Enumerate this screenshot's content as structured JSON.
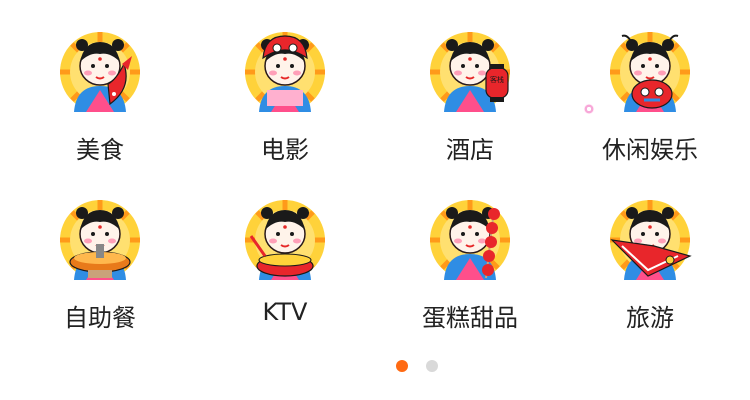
{
  "categories": [
    {
      "label": "美食",
      "icon": "fish-figure-icon"
    },
    {
      "label": "电影",
      "icon": "lion-mask-figure-icon"
    },
    {
      "label": "酒店",
      "icon": "lantern-figure-icon"
    },
    {
      "label": "休闲娱乐",
      "icon": "tiger-figure-icon"
    },
    {
      "label": "自助餐",
      "icon": "hotpot-figure-icon"
    },
    {
      "label": "KTV",
      "icon": "drum-figure-icon"
    },
    {
      "label": "蛋糕甜品",
      "icon": "candied-haws-figure-icon"
    },
    {
      "label": "旅游",
      "icon": "kite-figure-icon"
    }
  ],
  "lantern_text": "客栈",
  "pager": {
    "pages": 2,
    "current": 1
  },
  "colors": {
    "active_dot": "#ff6a13",
    "inactive_dot": "#d9d9d9",
    "label": "#222222"
  }
}
